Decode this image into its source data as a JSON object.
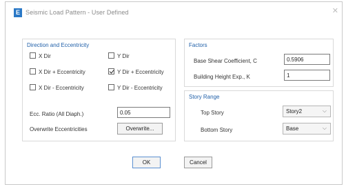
{
  "window": {
    "title": "Seismic Load Pattern - User Defined",
    "app_icon_letter": "E"
  },
  "direction": {
    "title": "Direction and Eccentricity",
    "checkboxes": [
      {
        "label": "X Dir",
        "checked": false
      },
      {
        "label": "Y Dir",
        "checked": false
      },
      {
        "label": "X Dir + Eccentricity",
        "checked": false
      },
      {
        "label": "Y Dir + Eccentricity",
        "checked": true
      },
      {
        "label": "X Dir - Eccentricity",
        "checked": false
      },
      {
        "label": "Y Dir - Eccentricity",
        "checked": false
      }
    ],
    "ecc_label": "Ecc. Ratio (All Diaph.)",
    "ecc_value": "0.05",
    "overwrite_label": "Overwrite Eccentricities",
    "overwrite_button": "Overwrite..."
  },
  "factors": {
    "title": "Factors",
    "base_shear_label": "Base Shear Coefficient, C",
    "base_shear_value": "0.5906",
    "height_exp_label": "Building Height Exp., K",
    "height_exp_value": "1"
  },
  "story_range": {
    "title": "Story Range",
    "top_label": "Top Story",
    "top_value": "Story2",
    "bottom_label": "Bottom Story",
    "bottom_value": "Base"
  },
  "buttons": {
    "ok": "OK",
    "cancel": "Cancel"
  }
}
